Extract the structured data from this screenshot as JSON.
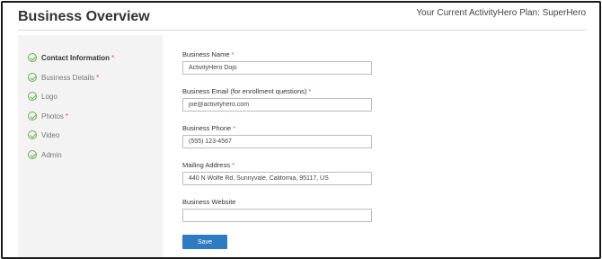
{
  "header": {
    "title": "Business Overview",
    "plan_text": "Your Current ActivityHero Plan: SuperHero"
  },
  "sidebar": {
    "items": [
      {
        "label": "Contact Information",
        "required": "*",
        "icon": "check-circle-icon"
      },
      {
        "label": "Business Details",
        "required": "*",
        "icon": "check-circle-icon"
      },
      {
        "label": "Logo",
        "required": "",
        "icon": "check-circle-icon"
      },
      {
        "label": "Photos",
        "required": "*",
        "icon": "check-circle-icon"
      },
      {
        "label": "Video",
        "required": "",
        "icon": "check-circle-icon"
      },
      {
        "label": "Admin",
        "required": "",
        "icon": "check-circle-icon"
      }
    ],
    "active_index": 0
  },
  "form": {
    "fields": [
      {
        "label": "Business Name",
        "required": "*",
        "value": "ActivityHero Dojo"
      },
      {
        "label": "Business Email (for enrollment questions)",
        "required": "*",
        "value": "joe@activityhero.com"
      },
      {
        "label": "Business Phone",
        "required": "*",
        "value": "(555) 123-4567"
      },
      {
        "label": "Mailing Address",
        "required": "*",
        "value": "440 N Wolfe Rd, Sunnyvale, California, 95117, US"
      },
      {
        "label": "Business Website",
        "required": "",
        "value": ""
      }
    ],
    "save_label": "Save"
  },
  "colors": {
    "accent": "#2e7bc4",
    "check": "#6ab04c",
    "required": "#d9534f",
    "sidebar_bg": "#f3f3f3"
  }
}
